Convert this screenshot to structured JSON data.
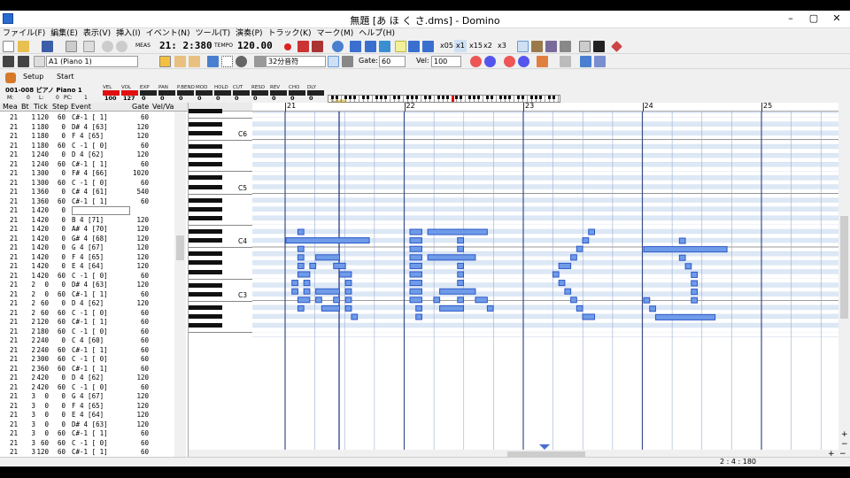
{
  "window": {
    "title": "無題 [あ ほ く さ.dms] - Domino",
    "minimize": "–",
    "maximize": "▢",
    "close": "✕"
  },
  "menu": [
    "ファイル(F)",
    "編集(E)",
    "表示(V)",
    "挿入(I)",
    "イベント(N)",
    "ツール(T)",
    "演奏(P)",
    "トラック(K)",
    "マーク(M)",
    "ヘルプ(H)"
  ],
  "toolbar1": {
    "meas_label": "MEAS",
    "position": "21: 2:380",
    "tempo_label": "TEMPO",
    "tempo": "120.00",
    "speeds": [
      "x05",
      "x1",
      "x15",
      "x2",
      "x3"
    ]
  },
  "toolbar2": {
    "track": "A1 (Piano 1)",
    "note_length": "32分音符",
    "gate_label": "Gate:",
    "gate_value": "60",
    "vel_label": "Vel:",
    "vel_value": "100"
  },
  "tabs": [
    "Setup",
    "Start"
  ],
  "trackinfo": {
    "name": "001-008 ピアノ Piano 1",
    "m_label": "M:",
    "m": "0",
    "l_label": "L:",
    "l": "0",
    "pc_label": "PC:",
    "pc": "1",
    "controls": [
      {
        "label": "VEL",
        "value": "100"
      },
      {
        "label": "VOL",
        "value": "127"
      },
      {
        "label": "EXP",
        "value": "0"
      },
      {
        "label": "PAN",
        "value": "0"
      },
      {
        "label": "P.BEND",
        "value": "0"
      },
      {
        "label": "MOD",
        "value": "0"
      },
      {
        "label": "HOLD",
        "value": "0"
      },
      {
        "label": "CUT",
        "value": "0"
      },
      {
        "label": "RESO",
        "value": "0"
      },
      {
        "label": "REV",
        "value": "0"
      },
      {
        "label": "CHO",
        "value": "0"
      },
      {
        "label": "DLY",
        "value": "0"
      }
    ],
    "keyboard_label": "7HMIN"
  },
  "eventlist": {
    "headers": [
      "Mea",
      "Bt",
      "Tick",
      "Step",
      "Event",
      "Gate",
      "Vel/Va"
    ],
    "rows": [
      [
        "21",
        "1",
        "120",
        "60",
        "C#-1 [ 1]",
        "60"
      ],
      [
        "21",
        "1",
        "180",
        "0",
        "D# 4 [63]",
        "120"
      ],
      [
        "21",
        "1",
        "180",
        "0",
        "F 4 [65]",
        "120"
      ],
      [
        "21",
        "1",
        "180",
        "60",
        "C -1 [ 0]",
        "60"
      ],
      [
        "21",
        "1",
        "240",
        "0",
        "D 4 [62]",
        "120"
      ],
      [
        "21",
        "1",
        "240",
        "60",
        "C#-1 [ 1]",
        "60"
      ],
      [
        "21",
        "1",
        "300",
        "0",
        "F# 4 [66]",
        "1020"
      ],
      [
        "21",
        "1",
        "300",
        "60",
        "C -1 [ 0]",
        "60"
      ],
      [
        "21",
        "1",
        "360",
        "0",
        "C# 4 [61]",
        "540"
      ],
      [
        "21",
        "1",
        "360",
        "60",
        "C#-1 [ 1]",
        "60"
      ],
      [
        "21",
        "1",
        "420",
        "0",
        "",
        ""
      ],
      [
        "21",
        "1",
        "420",
        "0",
        "B 4 [71]",
        "120"
      ],
      [
        "21",
        "1",
        "420",
        "0",
        "A# 4 [70]",
        "120"
      ],
      [
        "21",
        "1",
        "420",
        "0",
        "G# 4 [68]",
        "120"
      ],
      [
        "21",
        "1",
        "420",
        "0",
        "G 4 [67]",
        "120"
      ],
      [
        "21",
        "1",
        "420",
        "0",
        "F 4 [65]",
        "120"
      ],
      [
        "21",
        "1",
        "420",
        "0",
        "E 4 [64]",
        "120"
      ],
      [
        "21",
        "1",
        "420",
        "60",
        "C -1 [ 0]",
        "60"
      ],
      [
        "21",
        "2",
        "0",
        "0",
        "D# 4 [63]",
        "120"
      ],
      [
        "21",
        "2",
        "0",
        "60",
        "C#-1 [ 1]",
        "60"
      ],
      [
        "21",
        "2",
        "60",
        "0",
        "D 4 [62]",
        "120"
      ],
      [
        "21",
        "2",
        "60",
        "60",
        "C -1 [ 0]",
        "60"
      ],
      [
        "21",
        "2",
        "120",
        "60",
        "C#-1 [ 1]",
        "60"
      ],
      [
        "21",
        "2",
        "180",
        "60",
        "C -1 [ 0]",
        "60"
      ],
      [
        "21",
        "2",
        "240",
        "0",
        "C 4 [60]",
        "60"
      ],
      [
        "21",
        "2",
        "240",
        "60",
        "C#-1 [ 1]",
        "60"
      ],
      [
        "21",
        "2",
        "300",
        "60",
        "C -1 [ 0]",
        "60"
      ],
      [
        "21",
        "2",
        "360",
        "60",
        "C#-1 [ 1]",
        "60"
      ],
      [
        "21",
        "2",
        "420",
        "0",
        "D 4 [62]",
        "120"
      ],
      [
        "21",
        "2",
        "420",
        "60",
        "C -1 [ 0]",
        "60"
      ],
      [
        "21",
        "3",
        "0",
        "0",
        "G 4 [67]",
        "120"
      ],
      [
        "21",
        "3",
        "0",
        "0",
        "F 4 [65]",
        "120"
      ],
      [
        "21",
        "3",
        "0",
        "0",
        "E 4 [64]",
        "120"
      ],
      [
        "21",
        "3",
        "0",
        "0",
        "D# 4 [63]",
        "120"
      ],
      [
        "21",
        "3",
        "0",
        "60",
        "C#-1 [ 1]",
        "60"
      ],
      [
        "21",
        "3",
        "60",
        "60",
        "C -1 [ 0]",
        "60"
      ],
      [
        "21",
        "3",
        "120",
        "60",
        "C#-1 [ 1]",
        "60"
      ]
    ]
  },
  "pianoroll": {
    "measures": [
      "21",
      "22",
      "23",
      "24",
      "25"
    ],
    "octave_labels": [
      "C6",
      "C5",
      "C4",
      "C3"
    ],
    "note_color": "#6f9be8",
    "note_border": "#2b58c8"
  },
  "statusbar": {
    "position": "2 : 4 : 180"
  }
}
